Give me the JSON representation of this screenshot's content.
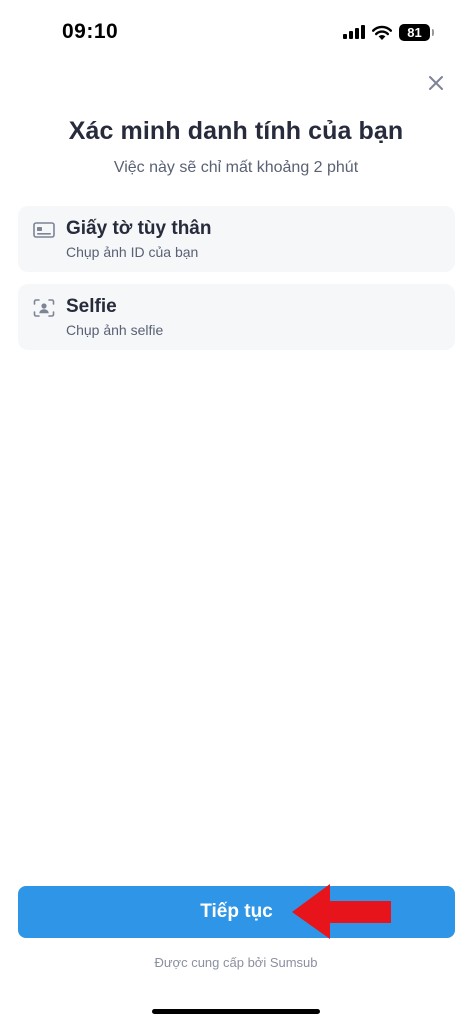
{
  "status_bar": {
    "time": "09:10",
    "battery_level": "81",
    "icons": [
      "cellular-signal-icon",
      "wifi-icon",
      "battery-icon"
    ]
  },
  "header": {
    "close_icon": "close-icon",
    "title": "Xác minh danh tính của bạn",
    "subtitle": "Việc này sẽ chỉ mất khoảng 2 phút"
  },
  "steps": [
    {
      "icon": "id-card-icon",
      "title": "Giấy tờ tùy thân",
      "description": "Chụp ảnh ID của bạn"
    },
    {
      "icon": "face-scan-icon",
      "title": "Selfie",
      "description": "Chụp ảnh selfie"
    }
  ],
  "actions": {
    "continue_label": "Tiếp tục",
    "annotation_icon": "red-arrow-icon"
  },
  "footer": {
    "powered_by": "Được cung cấp bởi Sumsub"
  },
  "colors": {
    "accent": "#2f95e6",
    "card_background": "#f6f7f9",
    "title_text": "#272b3b",
    "secondary_text": "#5a6174",
    "annotation": "#e8141b"
  }
}
